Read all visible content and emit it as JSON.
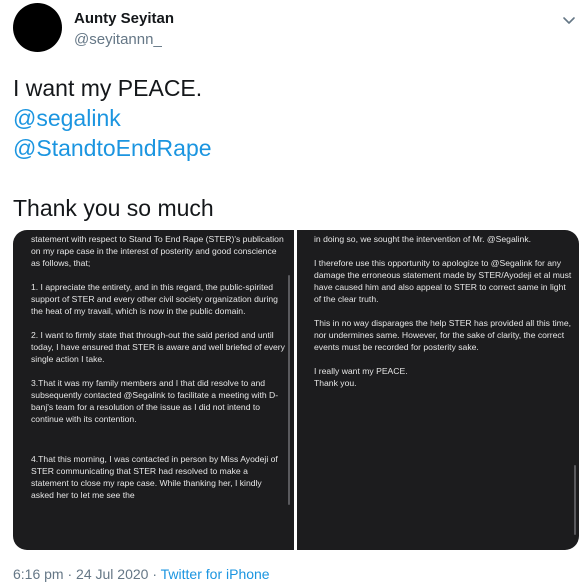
{
  "author": {
    "display_name": "Aunty Seyitan",
    "handle": "@seyitannn_"
  },
  "tweet": {
    "line1": "I want my PEACE.",
    "mention1": "@segalink",
    "mention2": "@StandtoEndRape",
    "line4": "Thank you so much"
  },
  "media": {
    "left_paragraphs": [
      "statement with respect to Stand To End Rape (STER)'s publication on my rape case in the interest of posterity and good conscience as follows, that;",
      "1. I appreciate the entirety, and in this regard, the public-spirited support of STER and every other civil society organization during the heat of my travail, which is now in the public domain.",
      "2. I want to firmly state that through-out the said period and until today, I have ensured that STER is aware and well briefed of every single action I take.",
      "3.That it was my family members and I that did resolve to and subsequently contacted @Segalink to facilitate a meeting with D-banj's team for a resolution of the issue as I did not intend to continue with its contention.",
      "4.That this morning, I was contacted in person by Miss Ayodeji of STER communicating that STER had resolved to make a statement to close my rape case. While thanking her, I kindly asked her to let me see the"
    ],
    "right_paragraphs": [
      "in doing so, we sought the intervention of Mr. @Segalink.",
      "I therefore use this opportunity to apologize to @Segalink for any damage the erroneous statement made by STER/Ayodeji et al must have caused him and also appeal to STER to correct same in light of the clear truth.",
      "This in no way disparages the help STER has provided all this time, nor undermines same. However, for the sake of clarity, the correct events must be recorded for posterity sake.",
      "I really want my PEACE.",
      "Thank you."
    ]
  },
  "meta": {
    "time": "6:16 pm",
    "separator": " · ",
    "date": "24 Jul 2020",
    "source": "Twitter for iPhone"
  },
  "colors": {
    "link": "#1b95e0",
    "secondary": "#657786",
    "panel_bg": "#1c1c1e"
  }
}
